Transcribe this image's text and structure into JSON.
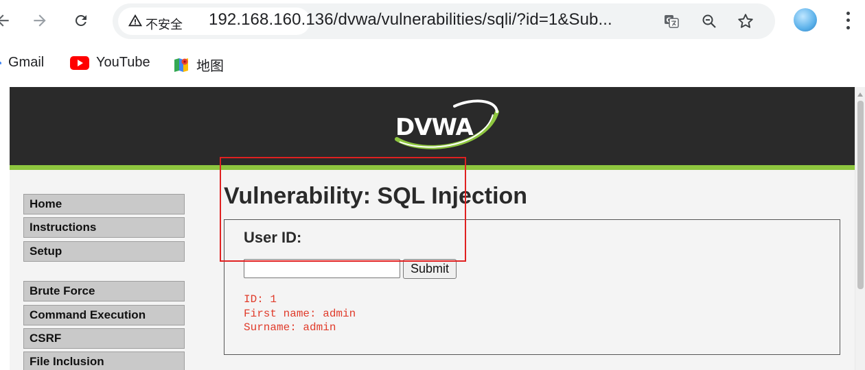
{
  "browser": {
    "security_label": "不安全",
    "url": "192.168.160.136/dvwa/vulnerabilities/sqli/?id=1&Sub...",
    "back_icon": "back-arrow-icon",
    "forward_icon": "forward-arrow-icon",
    "reload_icon": "reload-icon",
    "bookmarks": [
      {
        "label": "Gmail",
        "icon": "gmail-icon"
      },
      {
        "label": "YouTube",
        "icon": "youtube-icon"
      },
      {
        "label": "地图",
        "icon": "maps-icon"
      }
    ]
  },
  "colors": {
    "header_bg": "#2a2a2a",
    "accent_green": "#8ec63f",
    "page_bg": "#f4f4f4",
    "menu_bg": "#c9c9c9",
    "result_text": "#e03b2a",
    "highlight_border": "#e02020"
  },
  "header": {
    "logo_text": "DVWA"
  },
  "menu": {
    "items": [
      {
        "label": "Home"
      },
      {
        "label": "Instructions"
      },
      {
        "label": "Setup"
      },
      {
        "label": "Brute Force"
      },
      {
        "label": "Command Execution"
      },
      {
        "label": "CSRF"
      },
      {
        "label": "File Inclusion"
      }
    ]
  },
  "main": {
    "title": "Vulnerability: SQL Injection",
    "form": {
      "label": "User ID:",
      "input_value": "",
      "submit_label": "Submit"
    },
    "result": {
      "line1": "ID: 1",
      "line2": "First name: admin",
      "line3": "Surname: admin"
    }
  }
}
